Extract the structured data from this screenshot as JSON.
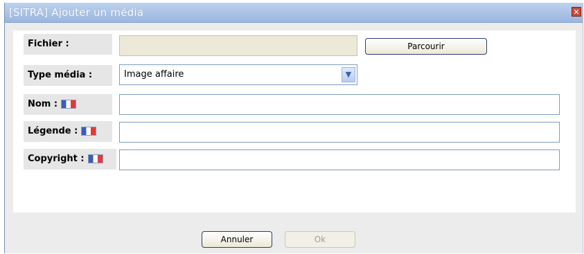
{
  "dialog": {
    "title": "[SITRA] Ajouter un média",
    "close_glyph": "✕"
  },
  "form": {
    "file_label": "Fichier :",
    "file_value": "",
    "browse_label": "Parcourir",
    "type_label": "Type média :",
    "type_value": "Image affaire",
    "name_label": "Nom :",
    "name_value": "",
    "caption_label": "Légende :",
    "caption_value": "",
    "copyright_label": "Copyright :",
    "copyright_value": ""
  },
  "buttons": {
    "cancel": "Annuler",
    "ok": "Ok"
  },
  "icons": {
    "flag": "french-flag-icon",
    "close": "close-icon",
    "dropdown": "chevron-down-icon"
  }
}
